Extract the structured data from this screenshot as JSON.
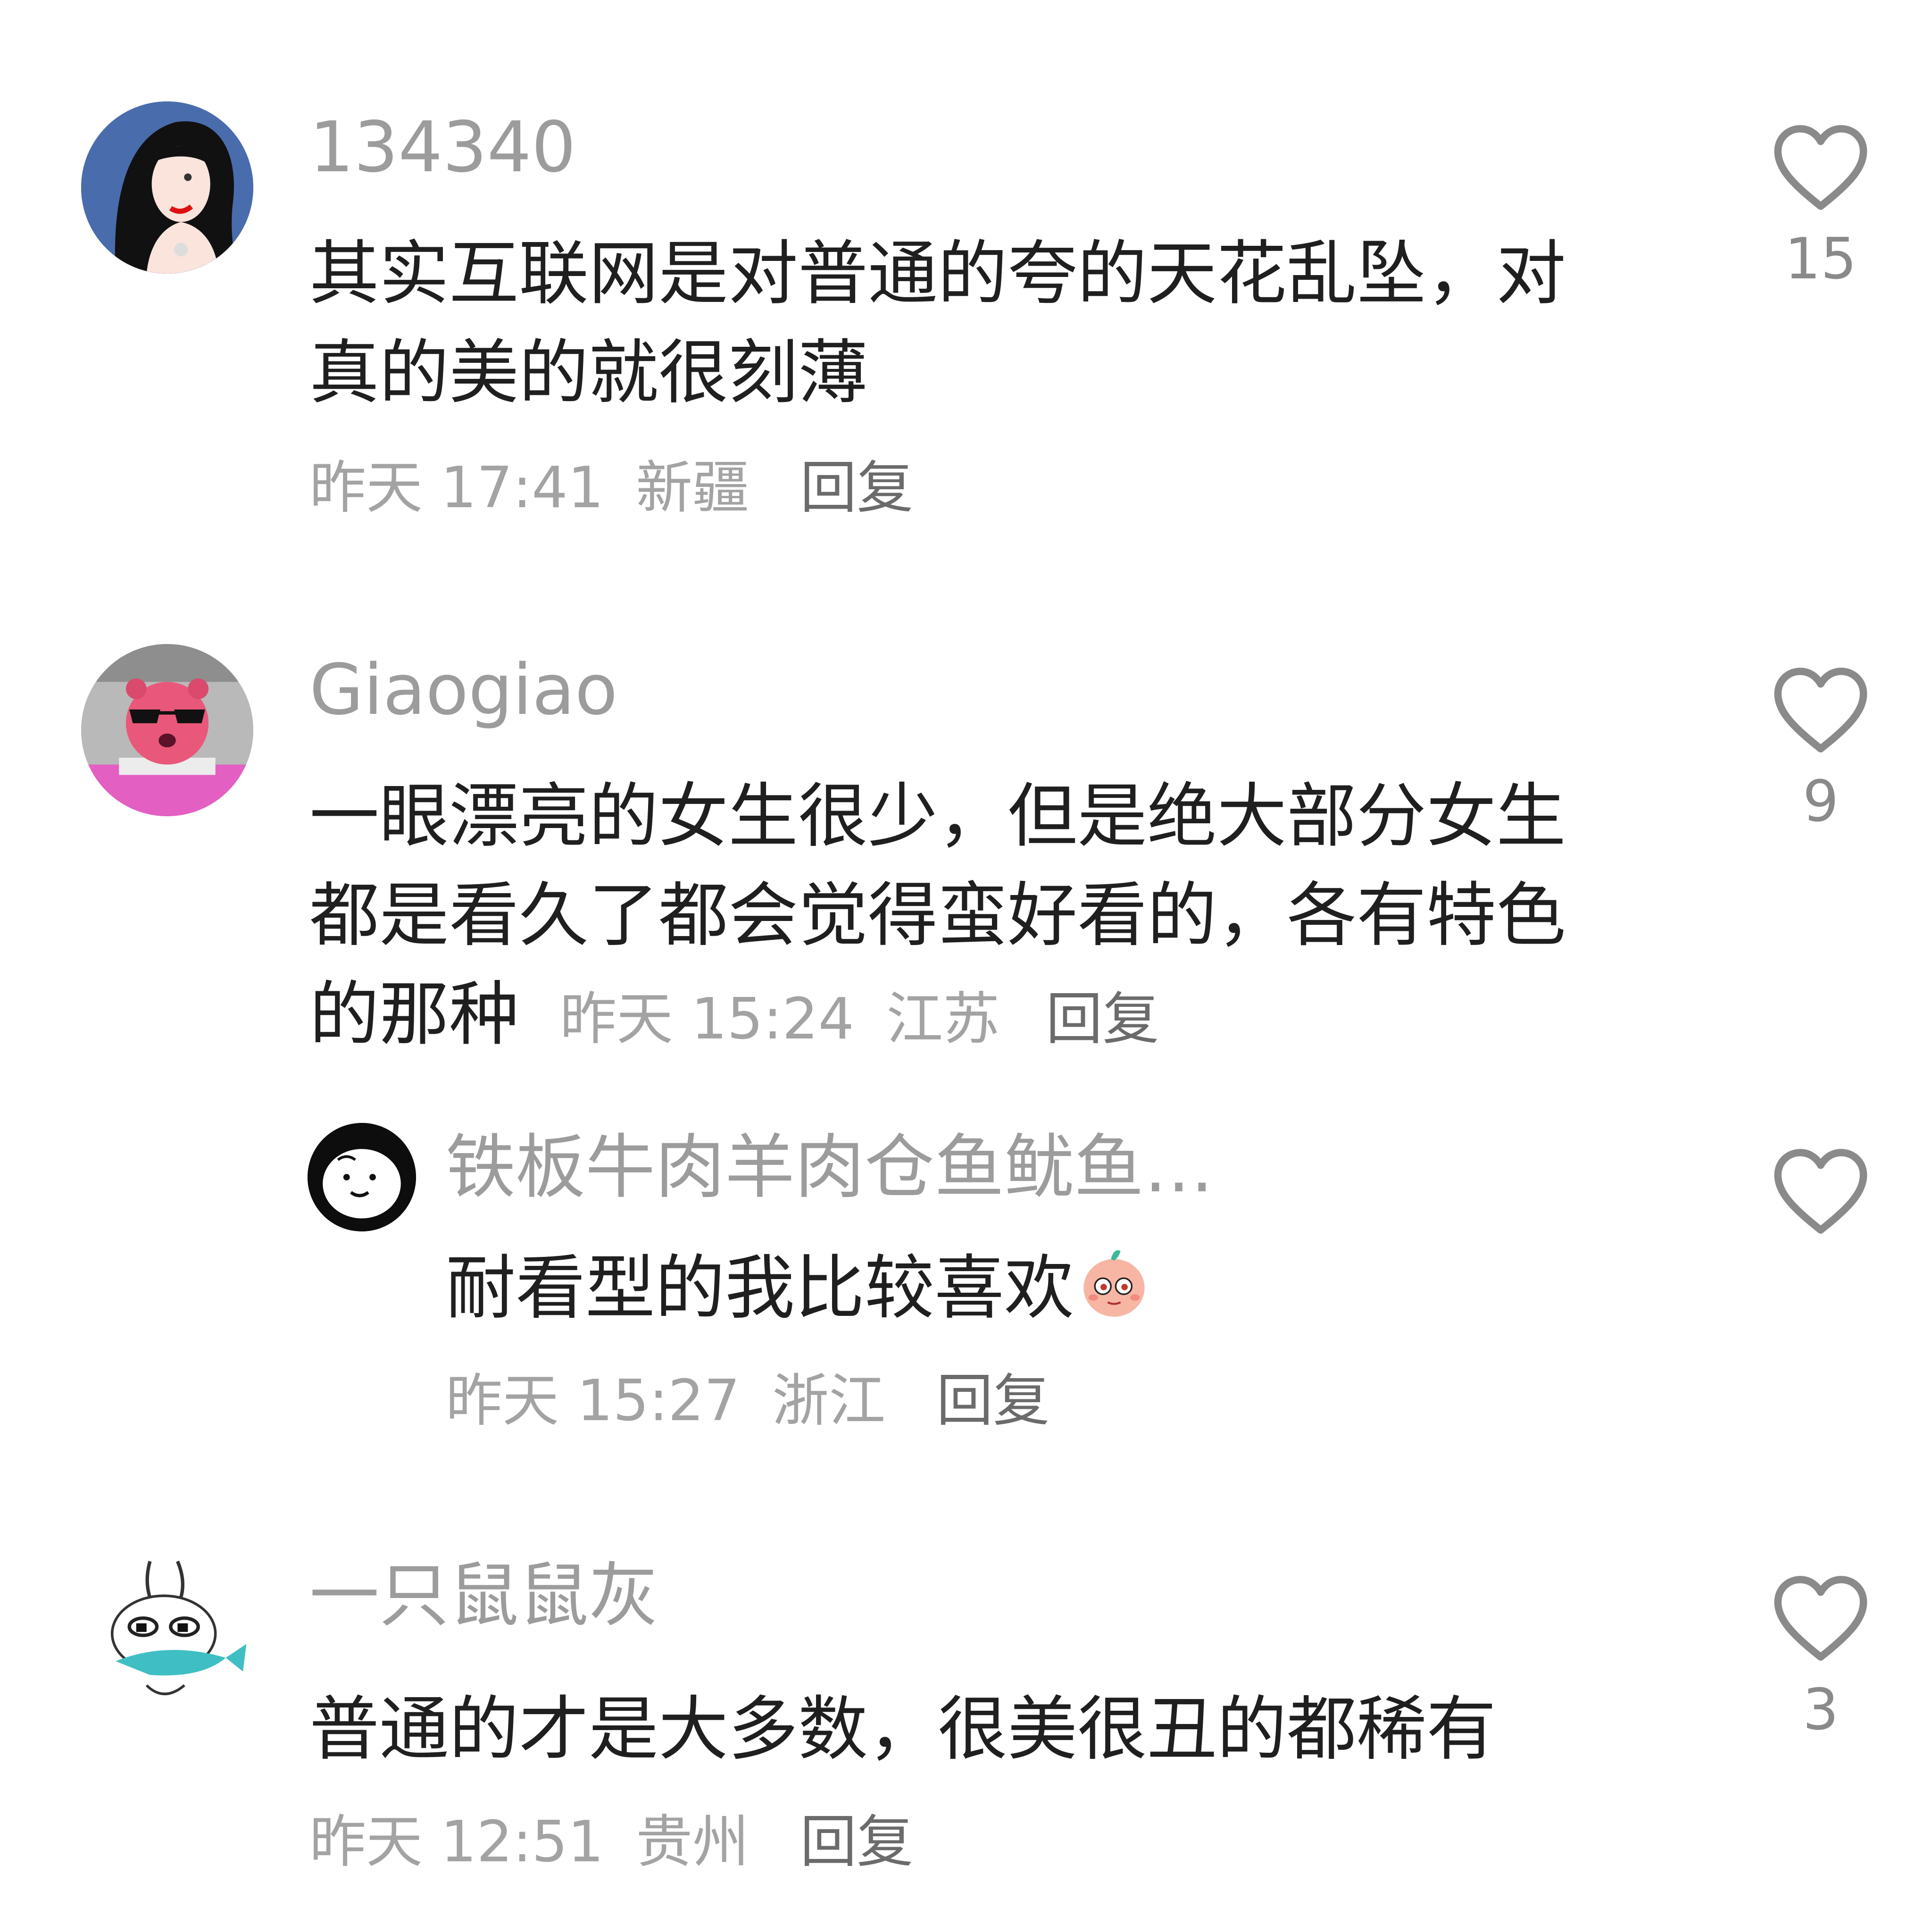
{
  "comments": [
    {
      "username": "134340",
      "text": "其实互联网是对普通的夸的天花乱坠，对真的美的就很刻薄",
      "time": "昨天 17:41",
      "location": "新疆",
      "reply_label": "回复",
      "likes": "15",
      "avatar_icon": "cartoon-woman-avatar"
    },
    {
      "username": "Giaogiao",
      "text": "一眼漂亮的女生很少，但是绝大部分女生都是看久了都会觉得蛮好看的，各有特色的那种",
      "time": "昨天 15:24",
      "location": "江苏",
      "reply_label": "回复",
      "likes": "9",
      "avatar_icon": "pink-beaver-sunglasses-avatar",
      "replies": [
        {
          "username": "铁板牛肉羊肉仓鱼鱿鱼",
          "ellipsis": "…",
          "text": "耐看型的我比较喜欢",
          "emoji": "shy-peach-emoji",
          "time": "昨天 15:27",
          "location": "浙江",
          "reply_label": "回复",
          "likes": "",
          "avatar_icon": "sketch-face-avatar"
        }
      ]
    },
    {
      "username": "一只鼠鼠灰",
      "text": "普通的才是大多数，很美很丑的都稀有",
      "time": "昨天 12:51",
      "location": "贵州",
      "reply_label": "回复",
      "likes": "3",
      "avatar_icon": "rabbit-with-fish-avatar"
    }
  ],
  "colors": {
    "username": "#9c9c9c",
    "text": "#1f1f1f",
    "meta": "#a3a3a3",
    "reply": "#6b6b6b",
    "heart_outline": "#8a8a8a"
  }
}
